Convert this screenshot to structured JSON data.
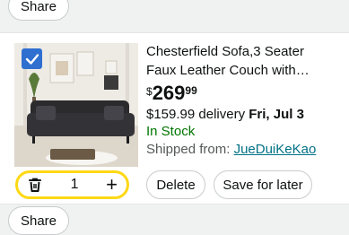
{
  "actions": {
    "share_label": "Share"
  },
  "item": {
    "title": "Chesterfield Sofa,3 Seater Faux Leather Couch with Pillows&B...",
    "price": {
      "symbol": "$",
      "whole": "269",
      "fraction": "99"
    },
    "delivery": {
      "prefix": "$159.99 delivery ",
      "date": "Fri, Jul 3"
    },
    "stock": "In Stock",
    "shipped_label": "Shipped from: ",
    "seller": "JueDuiKeKao",
    "selected": true
  },
  "quantity": {
    "value": "1"
  },
  "buttons": {
    "delete": "Delete",
    "save_for_later": "Save for later"
  },
  "colors": {
    "accent": "#ffd814",
    "checkbox": "#2f6fd0",
    "in_stock": "#007600",
    "link": "#007185"
  }
}
